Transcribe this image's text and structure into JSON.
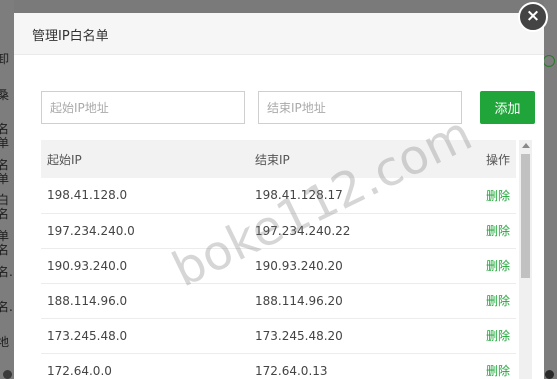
{
  "background": {
    "left_fragments": [
      "卸",
      "桑",
      "名单",
      "名单",
      "白名",
      "单名",
      "名.",
      "名.",
      "地"
    ]
  },
  "dialog": {
    "title": "管理IP白名单",
    "close_label": "×",
    "start_placeholder": "起始IP地址",
    "end_placeholder": "结束IP地址",
    "add_label": "添加",
    "columns": {
      "start": "起始IP",
      "end": "结束IP",
      "action": "操作"
    },
    "rows": [
      {
        "start": "198.41.128.0",
        "end": "198.41.128.17",
        "action": "删除"
      },
      {
        "start": "197.234.240.0",
        "end": "197.234.240.22",
        "action": "删除"
      },
      {
        "start": "190.93.240.0",
        "end": "190.93.240.20",
        "action": "删除"
      },
      {
        "start": "188.114.96.0",
        "end": "188.114.96.20",
        "action": "删除"
      },
      {
        "start": "173.245.48.0",
        "end": "173.245.48.20",
        "action": "删除"
      },
      {
        "start": "172.64.0.0",
        "end": "172.64.0.13",
        "action": "删除"
      }
    ]
  },
  "watermark": "boke112.com",
  "colors": {
    "accent": "#20a53a",
    "overlay": "#7a7a7a"
  }
}
